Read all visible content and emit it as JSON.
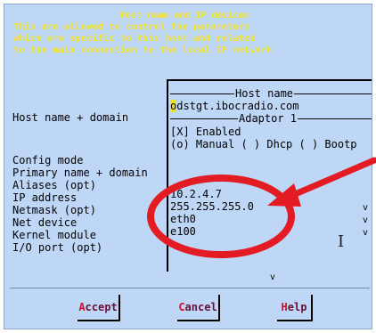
{
  "dialog": {
    "title": "Host name and IP devices",
    "header_lines": [
      "This are allowed to control the parameters",
      "which are specific to this host and related",
      "to the main connection to the local IP network"
    ]
  },
  "labels": {
    "host_name_domain": "Host name + domain",
    "config_mode": "Config mode",
    "primary_name_domain": "Primary name + domain",
    "aliases": "Aliases (opt)",
    "ip_address": "IP address",
    "netmask": "Netmask (opt)",
    "net_device": "Net device",
    "kernel_module": "Kernel module",
    "io_port": "I/O port (opt)"
  },
  "panel": {
    "host_name_heading": "Host name",
    "host_name_first_char": "o",
    "host_name_value_rest": "dstgt.ibocradio.com",
    "adaptor_heading": "Adaptor 1",
    "enabled": "[X] Enabled",
    "config_mode_options": "(o) Manual ( ) Dhcp ( ) Bootp",
    "ip_address": "10.2.4.7",
    "netmask": "255.255.255.0",
    "net_device": "eth0",
    "kernel_module": "e100",
    "scroll_marker": "v"
  },
  "buttons": {
    "accept": {
      "hot": "A",
      "rest": "ccept"
    },
    "cancel": {
      "hot": "C",
      "rest": "ancel"
    },
    "help": {
      "hot": "H",
      "rest": "elp"
    }
  },
  "annotation": {
    "color": "#e31b23"
  },
  "colors": {
    "background": "#bed7f6",
    "header_text": "#f2e12a",
    "button_text": "#6a1038"
  }
}
